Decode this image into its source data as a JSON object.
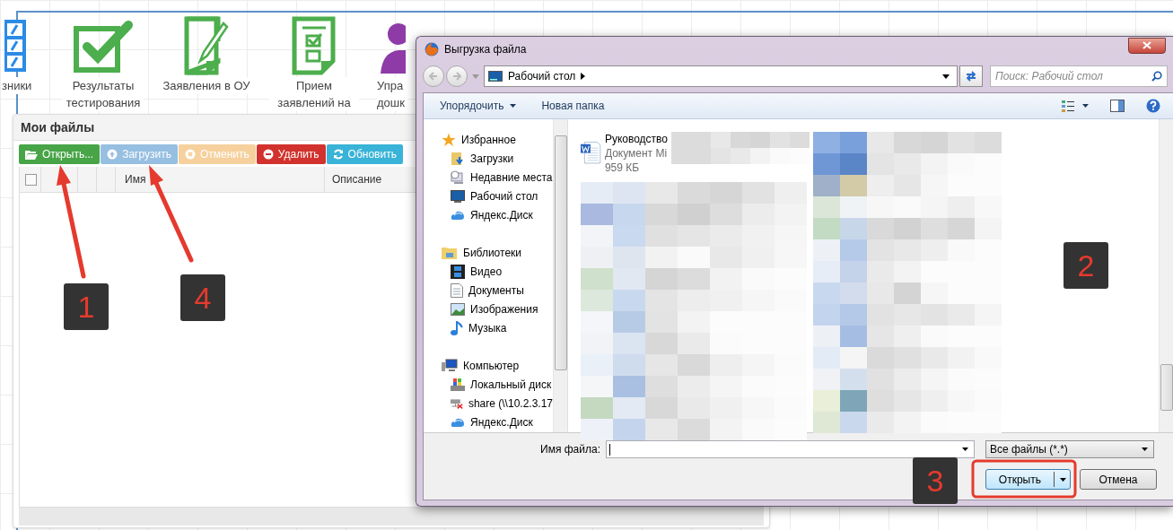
{
  "app_icons": [
    {
      "label": "зники",
      "kind": "grid"
    },
    {
      "label": "Результаты тестирования",
      "kind": "check"
    },
    {
      "label": "Заявления в ОУ",
      "kind": "pencil"
    },
    {
      "label": "Прием заявлений на",
      "kind": "form"
    },
    {
      "label": "Упра дошк",
      "kind": "person"
    }
  ],
  "panel": {
    "title": "Мои файлы",
    "toolbar": [
      {
        "label": "Открыть...",
        "kind": "open",
        "disabled": false
      },
      {
        "label": "Загрузить",
        "kind": "upload",
        "disabled": true
      },
      {
        "label": "Отменить",
        "kind": "cancel",
        "disabled": true
      },
      {
        "label": "Удалить",
        "kind": "delete",
        "disabled": false
      },
      {
        "label": "Обновить",
        "kind": "refresh",
        "disabled": false
      }
    ],
    "table": {
      "select_all": {
        "checked": false
      },
      "columns": [
        "Имя",
        "Описание"
      ]
    }
  },
  "dialog": {
    "title": "Выгрузка файла",
    "address": "Рабочий стол",
    "search": {
      "placeholder": "Поиск: Рабочий стол"
    },
    "toolbar": [
      {
        "label": "Упорядочить",
        "dropdown": true
      },
      {
        "label": "Новая папка",
        "dropdown": false
      }
    ],
    "nav": [
      {
        "label": "Избранное",
        "kind": "star",
        "children": [
          {
            "label": "Загрузки",
            "kind": "downloads"
          },
          {
            "label": "Недавние места",
            "kind": "recent"
          },
          {
            "label": "Рабочий стол",
            "kind": "desktop"
          },
          {
            "label": "Яндекс.Диск",
            "kind": "cloud"
          }
        ]
      },
      {
        "label": "Библиотеки",
        "kind": "library",
        "children": [
          {
            "label": "Видео",
            "kind": "video"
          },
          {
            "label": "Документы",
            "kind": "document"
          },
          {
            "label": "Изображения",
            "kind": "image"
          },
          {
            "label": "Музыка",
            "kind": "music"
          }
        ]
      },
      {
        "label": "Компьютер",
        "kind": "computer",
        "children": [
          {
            "label": "Локальный диск",
            "kind": "disk"
          },
          {
            "label": "share (\\\\10.2.3.17",
            "kind": "network"
          },
          {
            "label": "Яндекс.Диск",
            "kind": "cloud"
          }
        ]
      }
    ],
    "files": [
      {
        "name": "Руководство",
        "type": "Документ Mi",
        "size": "959 КБ"
      }
    ],
    "file_name": {
      "label": "Имя файла:"
    },
    "filter": "Все файлы (*.*)",
    "buttons": [
      {
        "label": "Открыть",
        "kind": "split"
      },
      {
        "label": "Отмена",
        "kind": "plain"
      }
    ]
  },
  "annotations": [
    {
      "label": "1"
    },
    {
      "label": "4"
    },
    {
      "label": "2"
    },
    {
      "label": "3"
    }
  ]
}
